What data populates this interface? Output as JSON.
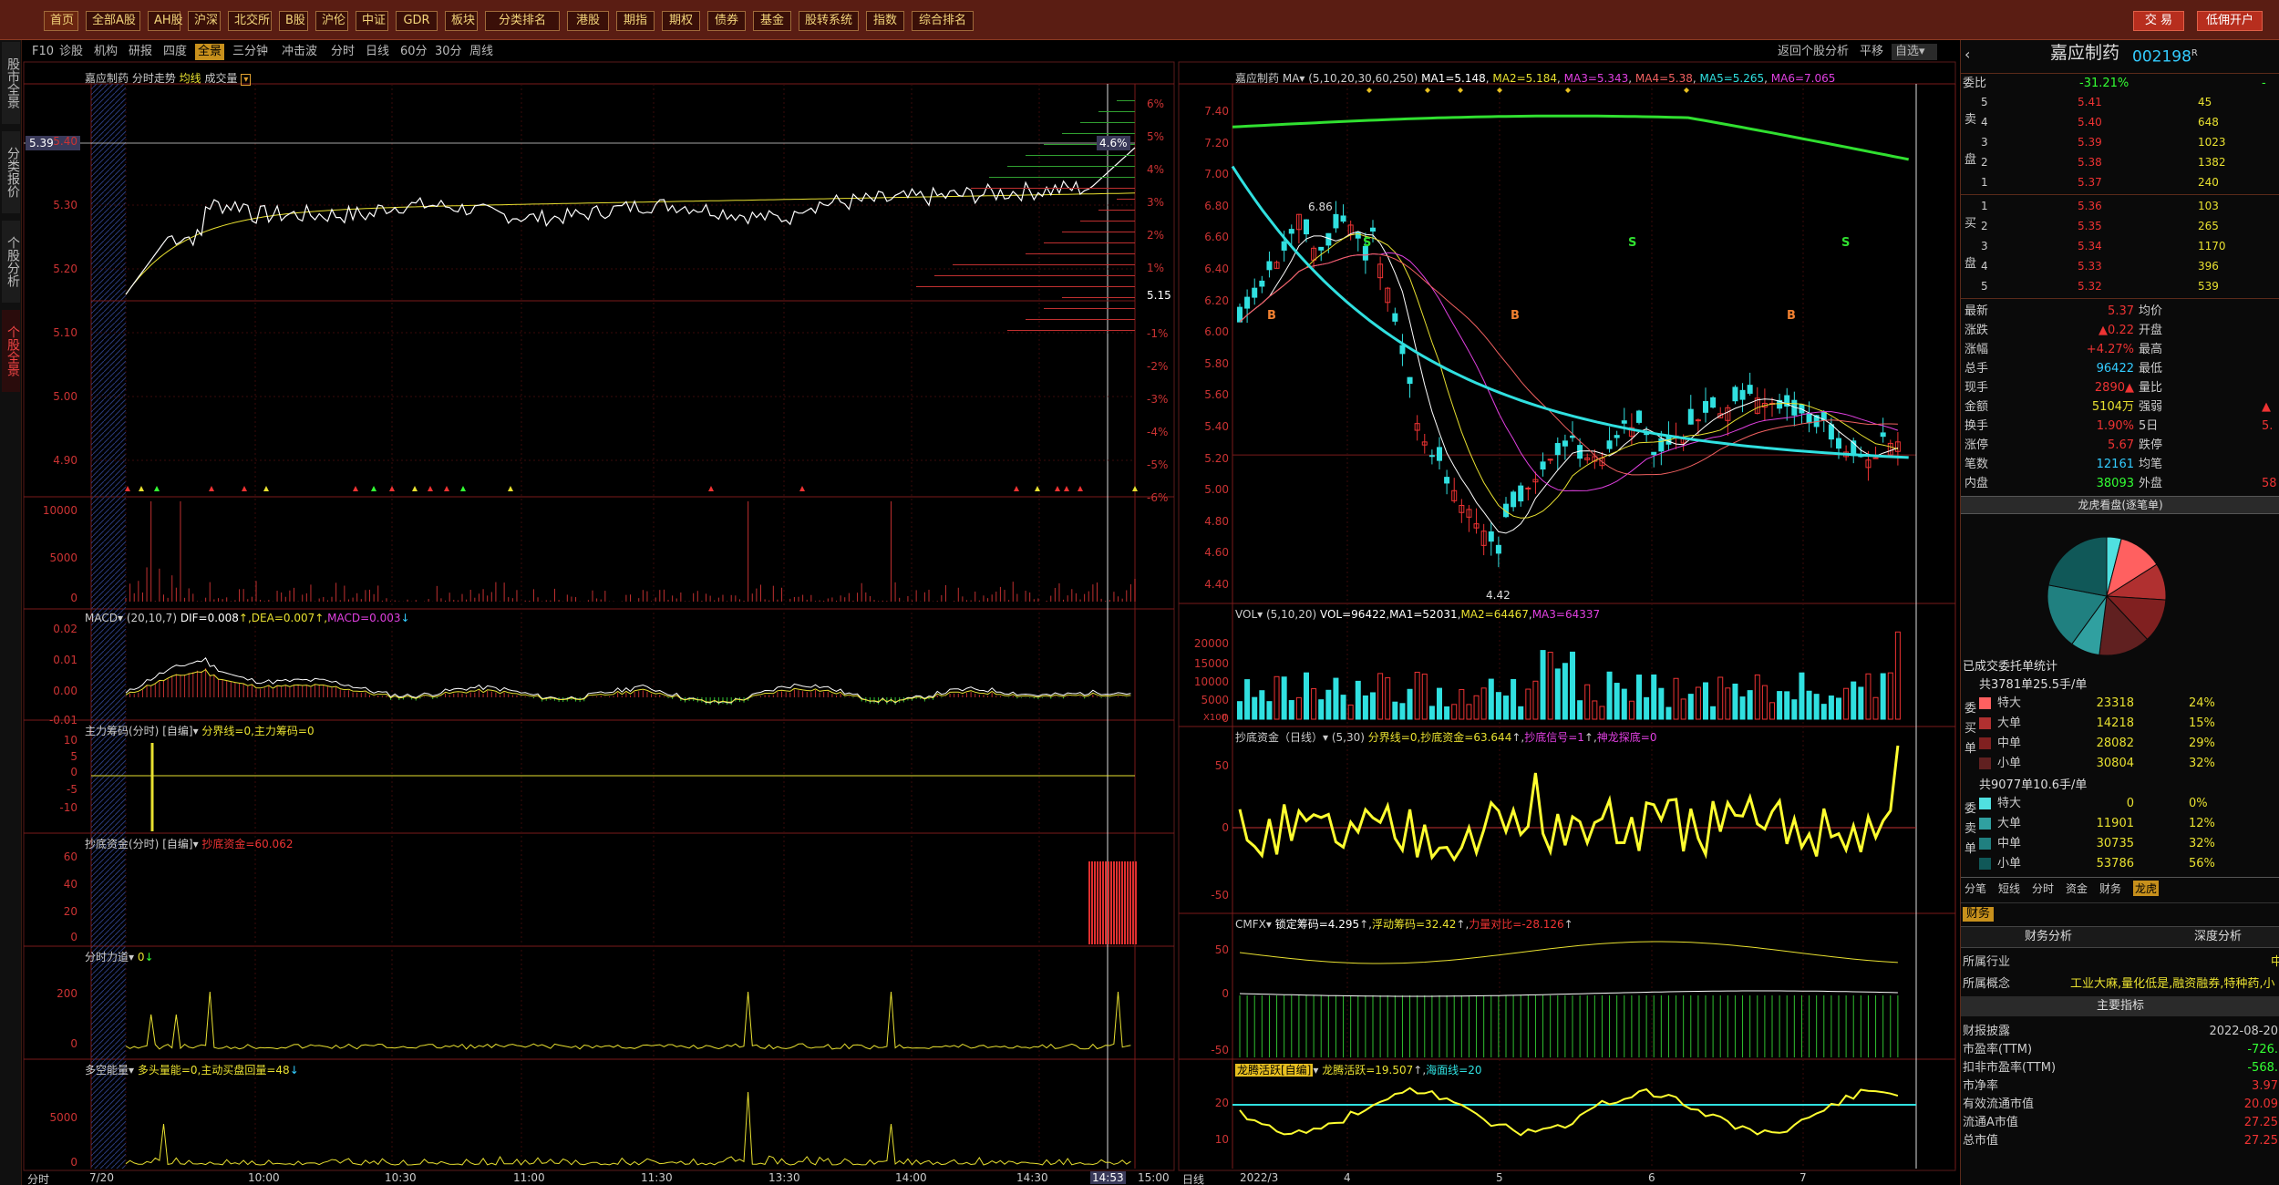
{
  "toolbar": {
    "items": [
      "首页",
      "全部A股",
      "AH股",
      "沪深",
      "北交所",
      "B股",
      "沪伦",
      "中证",
      "GDR",
      "板块",
      "分类排名",
      "港股",
      "期指",
      "期权",
      "债券",
      "基金",
      "股转系统",
      "指数",
      "综合排名"
    ],
    "trade": "交 易",
    "open_account": "低佣开户"
  },
  "left_sidebar": {
    "items": [
      "股市全景",
      "分类报价",
      "个股分析",
      "个股全景"
    ]
  },
  "tabs": {
    "items": [
      "F10",
      "诊股",
      "机构",
      "研报",
      "四度",
      "全景",
      "三分钟",
      "冲击波",
      "分时",
      "日线",
      "60分",
      "30分",
      "周线"
    ],
    "active": "全景",
    "right_items": [
      "返回个股分析",
      "平移",
      "自选"
    ]
  },
  "intraday": {
    "title": "嘉应制药  分时走势",
    "avg_label": "均线",
    "vol_label": "成交量",
    "price_box": "5.39",
    "pct_box": "4.6%",
    "mid_label": "5.15",
    "y_left": [
      "5.40",
      "5.30",
      "5.20",
      "5.10",
      "5.00",
      "4.90"
    ],
    "y_right": [
      "6%",
      "5%",
      "4%",
      "3%",
      "2%",
      "1%",
      "-1%",
      "-2%",
      "-3%",
      "-4%",
      "-5%",
      "-6%"
    ],
    "vol_axis": [
      "10000",
      "5000",
      "0"
    ],
    "macd": {
      "name": "MACD",
      "params": "(20,10,7)",
      "dif": "DIF=0.008",
      "dea": "DEA=0.007",
      "macd": "MACD=0.003",
      "axis": [
        "0.02",
        "0.01",
        "0.00",
        "-0.01"
      ]
    },
    "zl": {
      "name": "主力筹码(分时)",
      "param": "[自编]",
      "text": "分界线=0,主力筹码=0",
      "axis": [
        "10",
        "5",
        "0",
        "-5",
        "-10"
      ]
    },
    "cd": {
      "name": "抄底资金(分时)",
      "param": "[自编]",
      "text": "抄底资金=60.062",
      "axis": [
        "60",
        "40",
        "20",
        "0"
      ]
    },
    "fs": {
      "name": "分时力道",
      "text": "0",
      "axis": [
        "200",
        "0"
      ]
    },
    "dk": {
      "name": "多空能量",
      "text": "多头量能=0,主动买盘回量=48",
      "axis": [
        "5000",
        "0"
      ]
    },
    "x_labels": [
      "分时",
      "7/20",
      "10:00",
      "10:30",
      "11:00",
      "11:30",
      "13:30",
      "14:00",
      "14:30",
      "14:53",
      "15:00"
    ]
  },
  "kline": {
    "title": "嘉应制药",
    "ma_label": "MA",
    "params": "(5,10,20,30,60,250)",
    "ma1": "MA1=5.148",
    "ma2": "MA2=5.184",
    "ma3": "MA3=5.343",
    "ma4": "MA4=5.38",
    "ma5": "MA5=5.265",
    "ma6": "MA6=7.065",
    "y_axis": [
      "7.40",
      "7.20",
      "7.00",
      "6.80",
      "6.60",
      "6.40",
      "6.20",
      "6.00",
      "5.80",
      "5.60",
      "5.40",
      "5.20",
      "5.00",
      "4.80",
      "4.60",
      "4.40"
    ],
    "high_label": "6.86",
    "low_label": "4.42",
    "vol": {
      "name": "VOL",
      "params": "(5,10,20)",
      "val": "VOL=96422",
      "ma1": "MA1=52031",
      "ma2": "MA2=64467",
      "ma3": "MA3=64337",
      "axis": [
        "20000",
        "15000",
        "10000",
        "5000",
        "0"
      ],
      "unit": "X100"
    },
    "cd": {
      "name": "抄底资金（日线）",
      "params": "(5,30)",
      "text": "分界线=0,抄底资金=63.644",
      "text2": "抄底信号=1",
      "text3": "神龙探底=0",
      "axis": [
        "50",
        "0",
        "-50"
      ]
    },
    "cmfx": {
      "name": "CMFX",
      "text": "锁定筹码=4.295",
      "text2": "浮动筹码=32.42",
      "text3": "力量对比=-28.126",
      "axis": [
        "50",
        "0",
        "-50"
      ]
    },
    "lt": {
      "name": "龙腾活跃[自编]",
      "text": "龙腾活跃=19.507",
      "text2": "海面线=20",
      "axis": [
        "20",
        "10"
      ]
    },
    "x_labels": [
      "日线",
      "2022/3",
      "4",
      "5",
      "6",
      "7"
    ]
  },
  "stock": {
    "name": "嘉应制药",
    "code": "002198",
    "code_sup": "R",
    "wb_label": "委比",
    "wb": "-31.21%",
    "wb_num": "-",
    "sell": [
      {
        "l": "5",
        "p": "5.41",
        "v": "45"
      },
      {
        "l": "4",
        "p": "5.40",
        "v": "648"
      },
      {
        "l": "3",
        "p": "5.39",
        "v": "1023"
      },
      {
        "l": "2",
        "p": "5.38",
        "v": "1382"
      },
      {
        "l": "1",
        "p": "5.37",
        "v": "240"
      }
    ],
    "buy": [
      {
        "l": "1",
        "p": "5.36",
        "v": "103"
      },
      {
        "l": "2",
        "p": "5.35",
        "v": "265"
      },
      {
        "l": "3",
        "p": "5.34",
        "v": "1170"
      },
      {
        "l": "4",
        "p": "5.33",
        "v": "396"
      },
      {
        "l": "5",
        "p": "5.32",
        "v": "539"
      }
    ],
    "sell_labels": [
      "卖",
      "盘"
    ],
    "buy_labels": [
      "买",
      "盘"
    ],
    "quotes": [
      {
        "k": "最新",
        "v": "5.37",
        "k2": "均价",
        "v2": ""
      },
      {
        "k": "涨跌",
        "v": "▲0.22",
        "k2": "开盘",
        "v2": ""
      },
      {
        "k": "涨幅",
        "v": "+4.27%",
        "k2": "最高",
        "v2": ""
      },
      {
        "k": "总手",
        "v": "96422",
        "k2": "最低",
        "v2": ""
      },
      {
        "k": "现手",
        "v": "2890▲",
        "k2": "量比",
        "v2": ""
      },
      {
        "k": "金额",
        "v": "5104万",
        "k2": "强弱",
        "v2": "▲"
      },
      {
        "k": "换手",
        "v": "1.90%",
        "k2": "5日",
        "v2": "5."
      },
      {
        "k": "涨停",
        "v": "5.67",
        "k2": "跌停",
        "v2": ""
      },
      {
        "k": "笔数",
        "v": "12161",
        "k2": "均笔",
        "v2": ""
      },
      {
        "k": "内盘",
        "v": "38093",
        "k2": "外盘",
        "v2": "58"
      }
    ],
    "lhkp": "龙虎看盘(逐笔单)",
    "stats_title": "已成交委托单统计",
    "buy_stats_head": "共3781单25.5手/单",
    "buy_side_labels": [
      "委",
      "买",
      "单"
    ],
    "buy_stats": [
      {
        "n": "特大",
        "v": "23318",
        "p": "24%",
        "c": "#ff6060"
      },
      {
        "n": "大单",
        "v": "14218",
        "p": "15%",
        "c": "#b03030"
      },
      {
        "n": "中单",
        "v": "28082",
        "p": "29%",
        "c": "#802020"
      },
      {
        "n": "小单",
        "v": "30804",
        "p": "32%",
        "c": "#602020"
      }
    ],
    "sell_stats_head": "共9077单10.6手/单",
    "sell_side_labels": [
      "委",
      "卖",
      "单"
    ],
    "sell_stats": [
      {
        "n": "特大",
        "v": "0",
        "p": "0%",
        "c": "#50e0e0"
      },
      {
        "n": "大单",
        "v": "11901",
        "p": "12%",
        "c": "#30a0a0"
      },
      {
        "n": "中单",
        "v": "30735",
        "p": "32%",
        "c": "#208080"
      },
      {
        "n": "小单",
        "v": "53786",
        "p": "56%",
        "c": "#105858"
      }
    ],
    "bottom_tabs": [
      "分笔",
      "短线",
      "分时",
      "资金",
      "财务",
      "龙虎"
    ],
    "fin_tab": "财务",
    "fin_sub": [
      "财务分析",
      "深度分析"
    ],
    "info": [
      {
        "k": "所属行业",
        "v": "中"
      },
      {
        "k": "所属概念",
        "v": "工业大麻,量化低是,融资融券,特种药,小"
      }
    ],
    "main_index": "主要指标",
    "metrics": [
      {
        "k": "财报披露",
        "v": "2022-08-20"
      },
      {
        "k": "市盈率(TTM)",
        "v": "-726."
      },
      {
        "k": "扣非市盈率(TTM)",
        "v": "-568."
      },
      {
        "k": "市净率",
        "v": "3.97"
      },
      {
        "k": "有效流通市值",
        "v": "20.09"
      },
      {
        "k": "流通A市值",
        "v": "27.25"
      },
      {
        "k": "总市值",
        "v": "27.25"
      }
    ]
  },
  "colors": {
    "up": "#ff3030",
    "down": "#30e0e0",
    "line_white": "#ffffff",
    "avg_yellow": "#e8e030",
    "accent_gold": "#c7901c",
    "ma60": "#30e0e0",
    "ma250": "#30e030"
  }
}
